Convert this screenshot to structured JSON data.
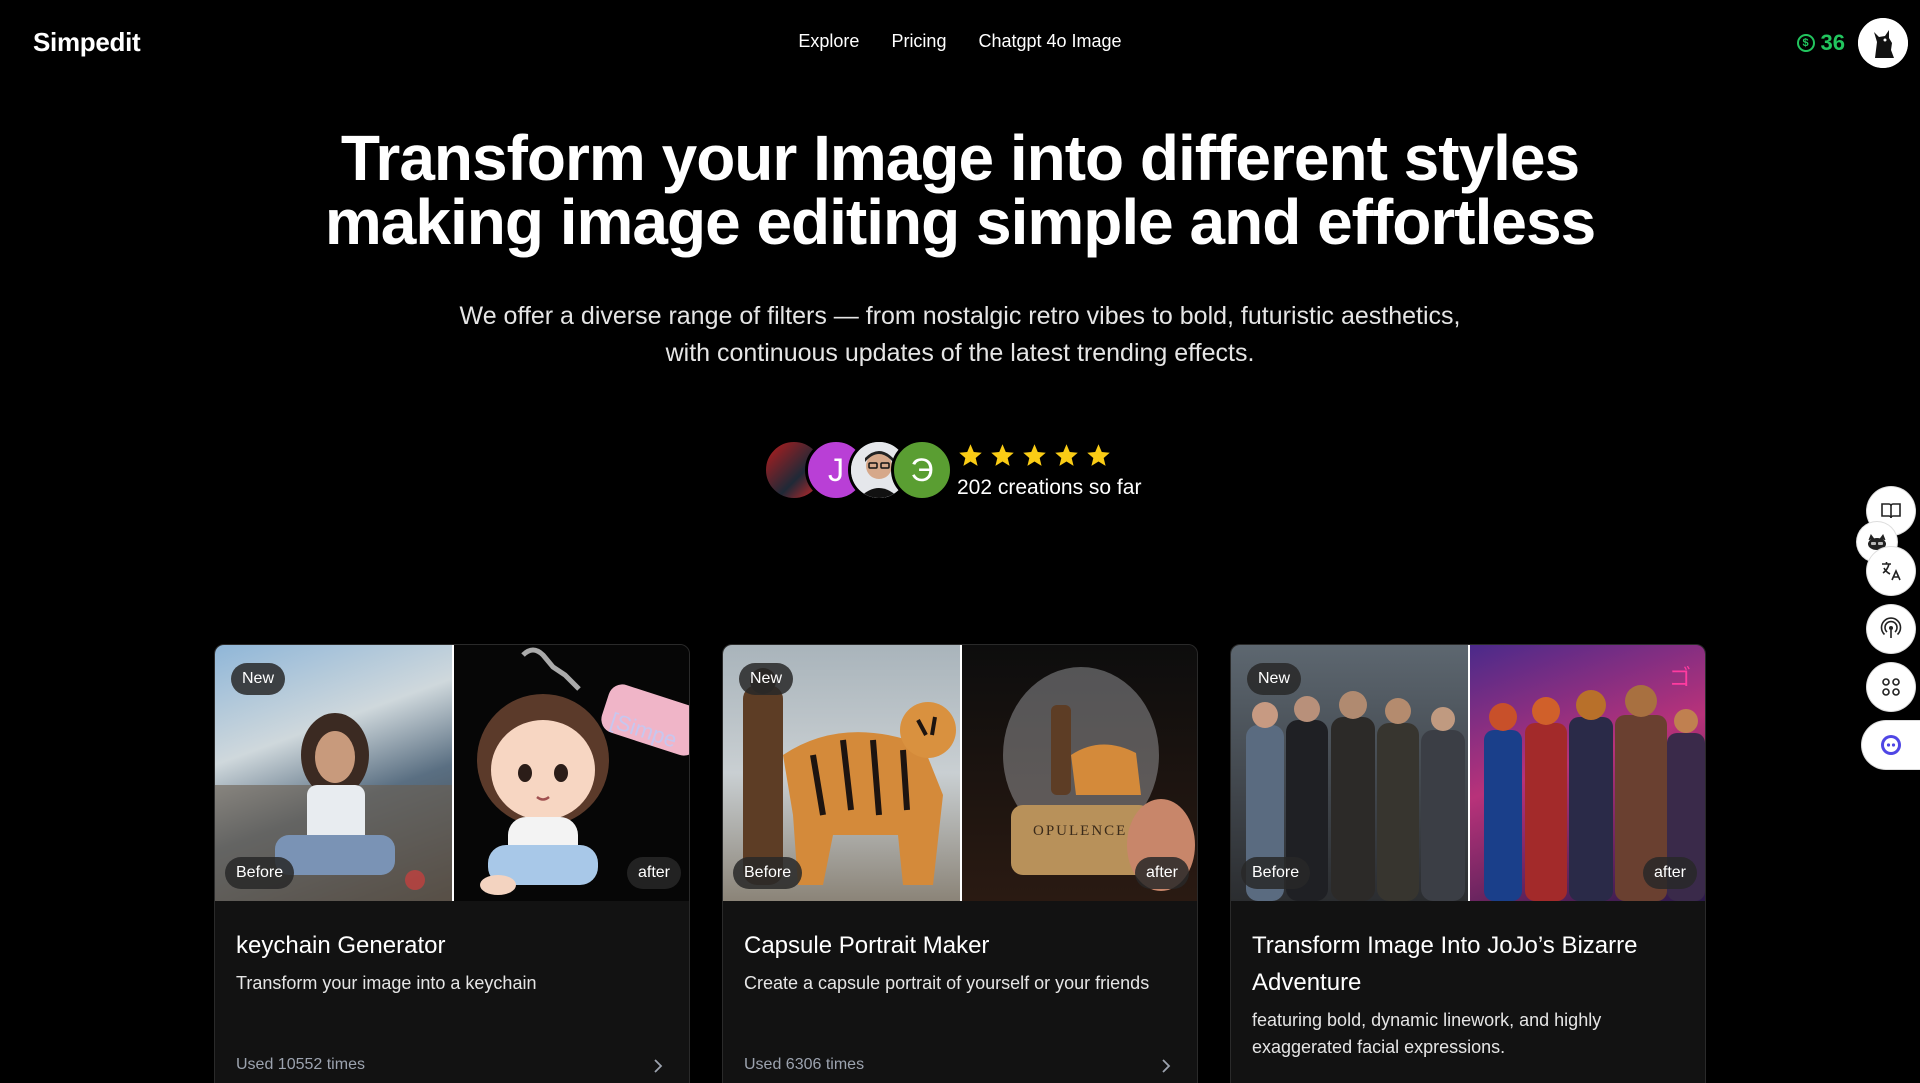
{
  "header": {
    "logo": "Simpedit",
    "nav": [
      "Explore",
      "Pricing",
      "Chatgpt 4o Image"
    ],
    "credits": "36",
    "credit_icon": "dollar-coin-icon"
  },
  "hero": {
    "title_line1": "Transform your Image into different styles",
    "title_line2": "making image editing simple and effortless",
    "subtitle_line1": "We offer a diverse range of filters — from nostalgic retro vibes to bold, futuristic aesthetics,",
    "subtitle_line2": "with continuous updates of the latest trending effects."
  },
  "social_proof": {
    "avatar_letters": [
      "J",
      "Э"
    ],
    "rating": 5,
    "creations": "202 creations so far"
  },
  "cards": [
    {
      "badge": "New",
      "before_label": "Before",
      "after_label": "after",
      "title": "keychain Generator",
      "description": "Transform your image into a keychain",
      "used": "Used 10552 times"
    },
    {
      "badge": "New",
      "before_label": "Before",
      "after_label": "after",
      "title": "Capsule Portrait Maker",
      "description": "Create a capsule portrait of yourself or your friends",
      "used": "Used 6306 times"
    },
    {
      "badge": "New",
      "before_label": "Before",
      "after_label": "after",
      "title": "Transform Image Into JoJo’s Bizarre Adventure",
      "description": "featuring bold, dynamic linework, and highly exaggerated facial expressions."
    }
  ],
  "side_buttons": [
    "book-icon",
    "translate-icon",
    "broadcast-icon",
    "grid-icon",
    "assistant-icon"
  ],
  "colors": {
    "background": "#000000",
    "card": "#121212",
    "accent_green": "#22c55e",
    "star": "#facc15"
  }
}
